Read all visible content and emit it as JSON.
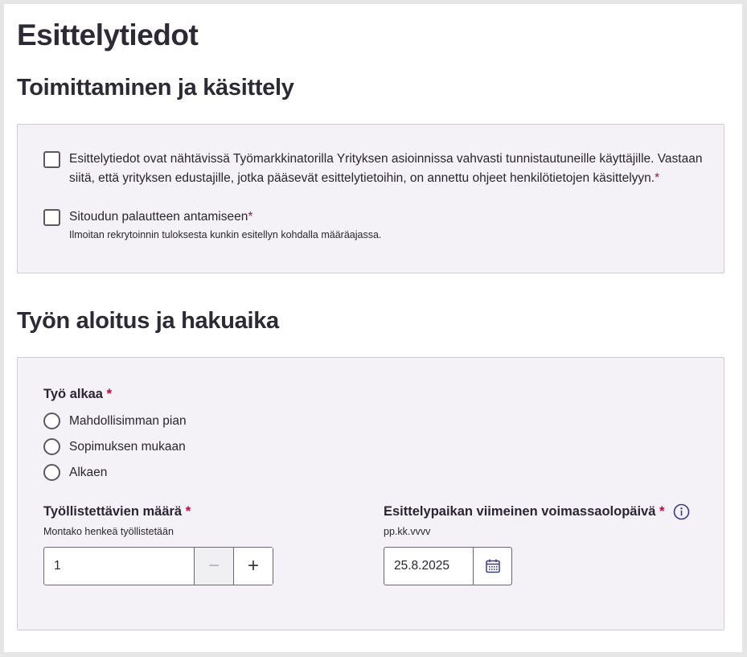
{
  "page_title": "Esittelytiedot",
  "section_handling": {
    "title": "Toimittaminen ja käsittely",
    "consent_checkbox": {
      "label": "Esittelytiedot ovat nähtävissä Työmarkkinatorilla Yrityksen asioinnissa vahvasti tunnistautuneille käyttäjille. Vastaan siitä, että yrityksen edustajille, jotka pääsevät esittelytietoihin, on annettu ohjeet henkilötietojen käsittelyyn.",
      "required_mark": "*"
    },
    "feedback_checkbox": {
      "label": "Sitoudun palautteen antamiseen",
      "required_mark": "*",
      "help": "Ilmoitan rekrytoinnin tuloksesta kunkin esitellyn kohdalla määräajassa."
    }
  },
  "section_start": {
    "title": "Työn aloitus ja hakuaika",
    "work_start": {
      "label": "Työ alkaa",
      "required_mark": "*",
      "options": [
        "Mahdollisimman pian",
        "Sopimuksen mukaan",
        "Alkaen"
      ]
    },
    "employees_count": {
      "label": "Työllistettävien määrä",
      "required_mark": "*",
      "help": "Montako henkeä työllistetään",
      "value": "1",
      "minus_symbol": "−",
      "plus_symbol": "+"
    },
    "valid_until": {
      "label": "Esittelypaikan viimeinen voimassaolopäivä",
      "required_mark": "*",
      "help": "pp.kk.vvvv",
      "value": "25.8.2025"
    }
  },
  "colors": {
    "panel_bg": "#f4f2f6",
    "required": "#c8003c",
    "icon": "#3c3a8a"
  },
  "icons": [
    "calendar-icon",
    "info-icon"
  ]
}
